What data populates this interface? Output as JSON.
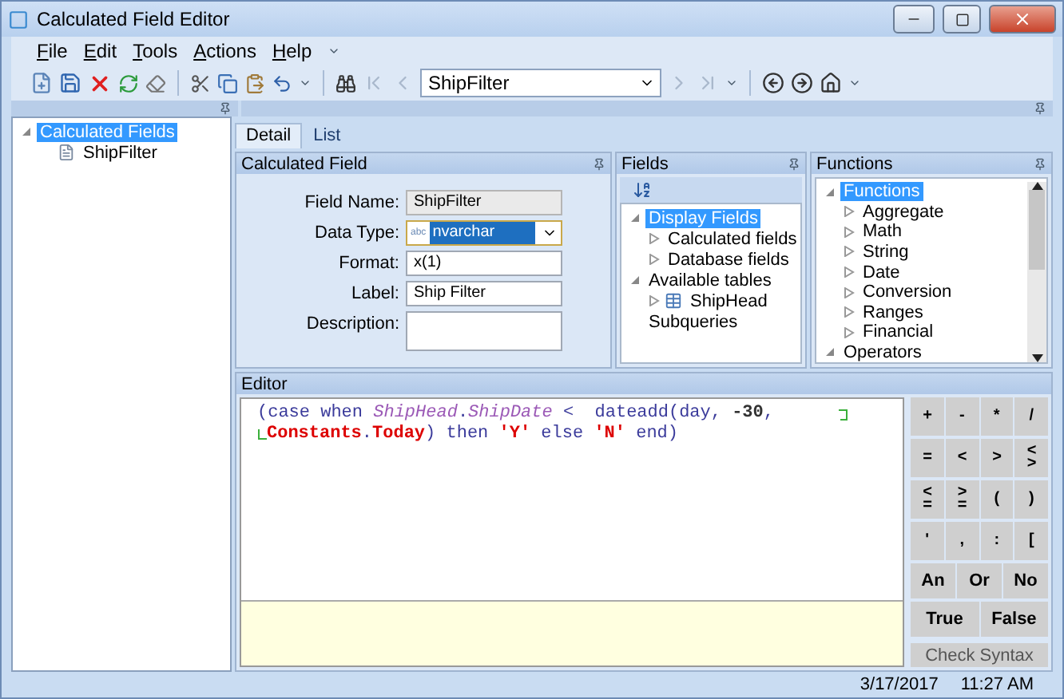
{
  "window": {
    "title": "Calculated Field Editor"
  },
  "menu": [
    {
      "label": "File"
    },
    {
      "label": "Edit"
    },
    {
      "label": "Tools"
    },
    {
      "label": "Actions"
    },
    {
      "label": "Help"
    }
  ],
  "toolbar": {
    "record": "ShipFilter",
    "nav": [
      {
        "kind": "first",
        "disabled": true
      },
      {
        "kind": "prev",
        "disabled": true
      },
      {
        "kind": "next",
        "disabled": true
      },
      {
        "kind": "last",
        "disabled": true
      }
    ]
  },
  "tree": [
    {
      "label": "Calculated Fields",
      "selected": true,
      "expanded": true,
      "children": [
        {
          "label": "ShipFilter",
          "selected": false
        }
      ]
    }
  ],
  "tabs": [
    {
      "label": "Detail",
      "selected": true
    },
    {
      "label": "List",
      "selected": false
    }
  ],
  "calculated_field": {
    "title": "Calculated Field",
    "fields": [
      {
        "label": "Field Name:",
        "kind": "readonly",
        "value": "ShipFilter"
      },
      {
        "label": "Data Type:",
        "kind": "combo",
        "value": "nvarchar",
        "prefix": "abc"
      },
      {
        "label": "Format:",
        "kind": "text",
        "value": "x(1)"
      },
      {
        "label": "Label:",
        "kind": "text",
        "value": "Ship Filter"
      },
      {
        "label": "Description:",
        "kind": "memo"
      }
    ]
  },
  "fields_panel": {
    "title": "Fields",
    "tree": [
      {
        "label": "Display Fields",
        "selected": true,
        "expanded": true,
        "children": [
          {
            "label": "Calculated fields",
            "expanded": false
          },
          {
            "label": "Database fields",
            "expanded": false
          }
        ]
      },
      {
        "label": "Available tables",
        "selected": false,
        "expanded": true,
        "children": [
          {
            "label": "ShipHead",
            "expanded": false,
            "kind": "table"
          }
        ]
      },
      {
        "label": "Subqueries",
        "selected": false
      }
    ]
  },
  "functions_panel": {
    "title": "Functions",
    "tree": [
      {
        "label": "Functions",
        "selected": true,
        "expanded": true,
        "children": [
          {
            "label": "Aggregate",
            "expanded": false
          },
          {
            "label": "Math",
            "expanded": false
          },
          {
            "label": "String",
            "expanded": false
          },
          {
            "label": "Date",
            "expanded": false
          },
          {
            "label": "Conversion",
            "expanded": false
          },
          {
            "label": "Ranges",
            "expanded": false
          },
          {
            "label": "Financial",
            "expanded": false
          }
        ]
      },
      {
        "label": "Operators",
        "selected": false,
        "expanded": true
      }
    ]
  },
  "editor": {
    "title": "Editor",
    "lines": [
      [
        {
          "kind": "plain",
          "text": "(case when "
        },
        {
          "kind": "field",
          "text": "ShipHead"
        },
        {
          "kind": "plain",
          "text": "."
        },
        {
          "kind": "field",
          "text": "ShipDate"
        },
        {
          "kind": "plain",
          "text": " <  dateadd(day, "
        },
        {
          "kind": "number",
          "text": "-30"
        },
        {
          "kind": "plain",
          "text": ","
        }
      ],
      [
        {
          "kind": "constant",
          "text": "Constants"
        },
        {
          "kind": "plain",
          "text": "."
        },
        {
          "kind": "constant",
          "text": "Today"
        },
        {
          "kind": "plain",
          "text": ") then "
        },
        {
          "kind": "string",
          "text": "'Y'"
        },
        {
          "kind": "plain",
          "text": " else "
        },
        {
          "kind": "string",
          "text": "'N'"
        },
        {
          "kind": "plain",
          "text": " end)"
        }
      ]
    ],
    "keypad": [
      [
        "+",
        "-",
        "*",
        "/"
      ],
      [
        "=",
        "<",
        ">",
        "<>"
      ],
      [
        "<=",
        ">=",
        "(",
        ")"
      ],
      [
        "'",
        ",",
        ":",
        "["
      ],
      [
        "An",
        "Or",
        "No"
      ],
      [
        "True",
        "False"
      ]
    ],
    "check_button": "Check Syntax"
  },
  "status_bar": {
    "date": "3/17/2017",
    "time": "11:27 AM"
  }
}
